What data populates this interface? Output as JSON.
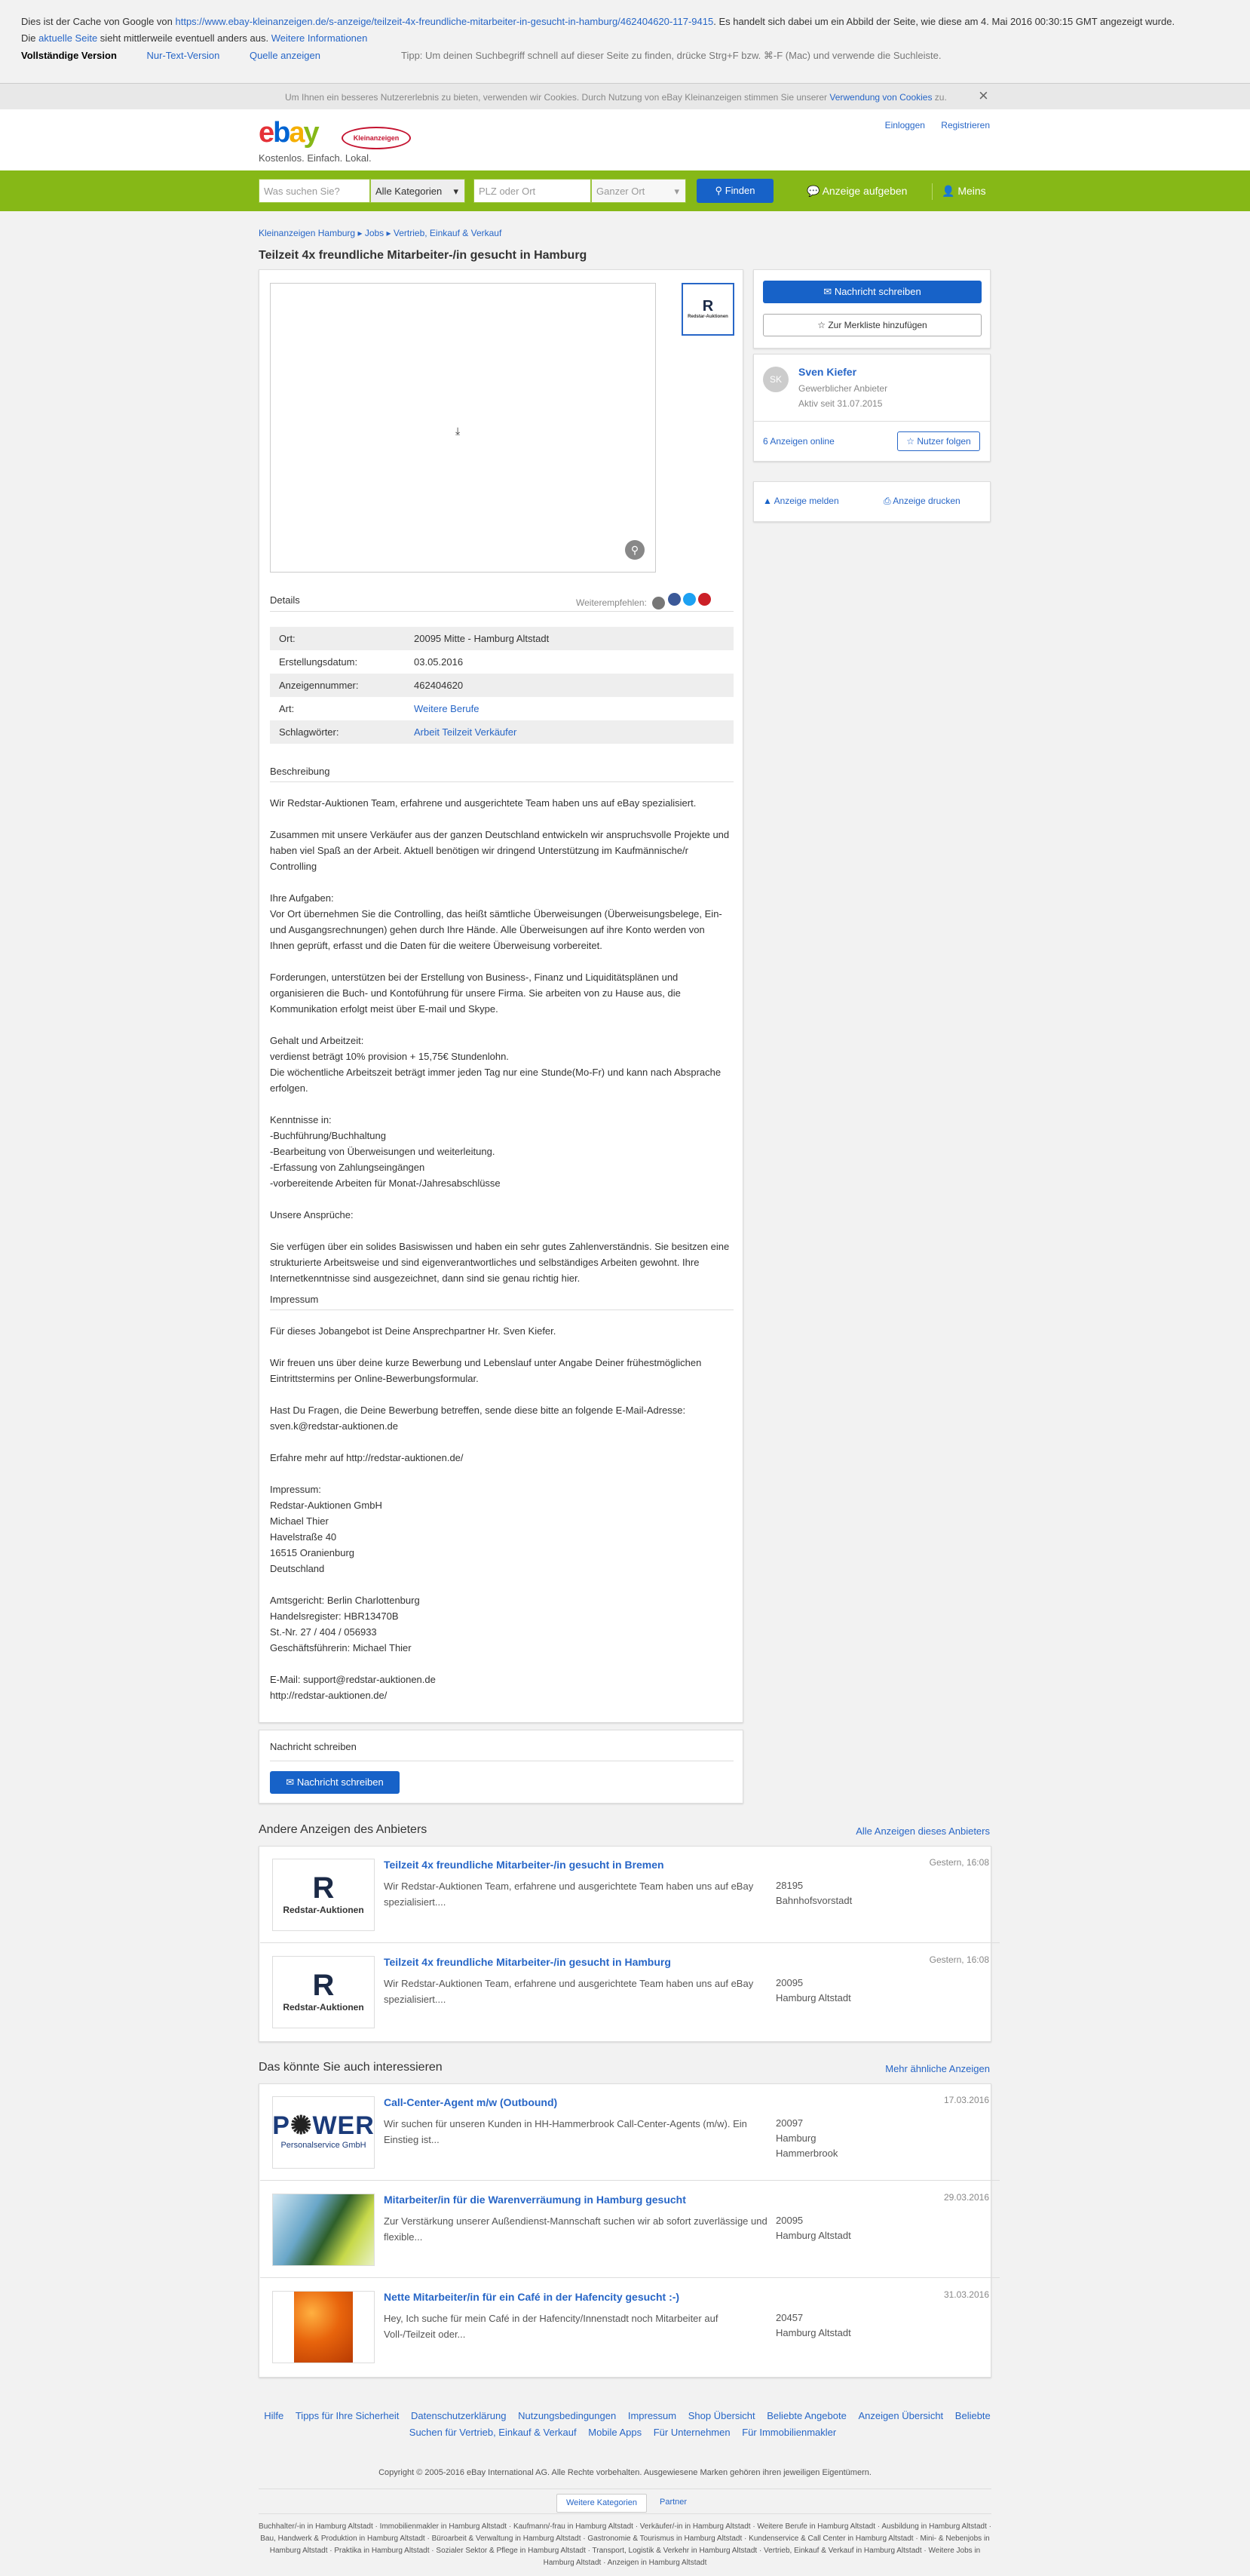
{
  "cache": {
    "p1_a": "Dies ist der Cache von Google von ",
    "p1_url": "https://www.ebay-kleinanzeigen.de/s-anzeige/teilzeit-4x-freundliche-mitarbeiter-in-gesucht-in-hamburg/462404620-117-9415",
    "p1_b": ". Es handelt sich dabei um ein Abbild der Seite, wie diese am 4. Mai 2016 00:30:15 GMT angezeigt wurde.",
    "p2_a": "Die ",
    "p2_link": "aktuelle Seite",
    "p2_b": " sieht mittlerweile eventuell anders aus. ",
    "p2_more": "Weitere Informationen",
    "full": "Vollständige Version",
    "text": "Nur-Text-Version",
    "source": "Quelle anzeigen",
    "tip": "Tipp: Um deinen Suchbegriff schnell auf dieser Seite zu finden, drücke Strg+F bzw. ⌘-F (Mac) und verwende die Suchleiste."
  },
  "cookie": {
    "text": "Um Ihnen ein besseres Nutzererlebnis zu bieten, verwenden wir Cookies. Durch Nutzung von eBay Kleinanzeigen stimmen Sie unserer ",
    "link": "Verwendung von Cookies",
    "end": " zu.",
    "close": "×"
  },
  "header": {
    "logo": "ebay",
    "badge": "Kleinanzeigen",
    "slogan": "Kostenlos. Einfach. Lokal.",
    "login": "Einloggen",
    "register": "Registrieren"
  },
  "search": {
    "placeholder": "Was suchen Sie?",
    "category": "Alle Kategorien",
    "plz": "PLZ oder Ort",
    "radius": "Ganzer Ort",
    "find": "Finden",
    "post": "Anzeige aufgeben",
    "mine": "Meins"
  },
  "breadcrumb": {
    "a": "Kleinanzeigen Hamburg",
    "b": "Jobs",
    "c": "Vertrieb, Einkauf & Verkauf"
  },
  "ad": {
    "title": "Teilzeit 4x freundliche Mitarbeiter-/in gesucht in Hamburg",
    "details": "Details",
    "share": "Weiterempfehlen:",
    "rows": [
      {
        "k": "Ort:",
        "v": "20095 Mitte - Hamburg Altstadt"
      },
      {
        "k": "Erstellungsdatum:",
        "v": "03.05.2016"
      },
      {
        "k": "Anzeigennummer:",
        "v": "462404620"
      },
      {
        "k": "Art:",
        "v": "Weitere Berufe"
      },
      {
        "k": "Schlagwörter:",
        "v": "Arbeit Teilzeit Verkäufer"
      }
    ],
    "desc_title": "Beschreibung",
    "description": "Wir Redstar-Auktionen Team, erfahrene und ausgerichtete Team haben uns auf eBay spezialisiert.\n\nZusammen mit unsere Verkäufer aus der ganzen Deutschland entwickeln wir anspruchsvolle Projekte und haben viel Spaß an der Arbeit. Aktuell benötigen wir dringend Unterstützung im Kaufmännische/r Controlling\n\nIhre Aufgaben:\nVor Ort übernehmen Sie die Controlling, das heißt sämtliche Überweisungen (Überweisungsbelege, Ein- und Ausgangsrechnungen) gehen durch Ihre Hände. Alle Überweisungen auf ihre Konto werden von Ihnen geprüft, erfasst und die Daten für die weitere Überweisung vorbereitet.\n\nForderungen, unterstützen bei der Erstellung von Business-, Finanz und Liquiditätsplänen und organisieren die Buch- und Kontoführung für unsere Firma. Sie arbeiten von zu Hause aus, die Kommunikation erfolgt meist über E-mail und Skype.\n\nGehalt und Arbeitzeit:\nverdienst beträgt 10% provision + 15,75€ Stundenlohn.\nDie wöchentliche Arbeitszeit beträgt immer jeden Tag nur eine Stunde(Mo-Fr) und kann nach Absprache erfolgen.\n\nKenntnisse in:\n-Buchführung/Buchhaltung\n-Bearbeitung von Überweisungen und weiterleitung.\n-Erfassung von Zahlungseingängen\n-vorbereitende Arbeiten für Monat-/Jahresabschlüsse\n\nUnsere Ansprüche:\n\nSie verfügen über ein solides Basiswissen und haben ein sehr gutes Zahlenverständnis. Sie besitzen eine strukturierte Arbeitsweise und sind eigenverantwortliches und selbständiges Arbeiten gewohnt. Ihre Internetkenntnisse sind ausgezeichnet, dann sind sie genau richtig hier.",
    "impressum_title": "Impressum",
    "impressum": "Für dieses Jobangebot ist Deine Ansprechpartner Hr. Sven Kiefer.\n\nWir freuen uns über deine kurze Bewerbung und Lebenslauf unter Angabe Deiner frühestmöglichen Eintrittstermins per Online-Bewerbungsformular.\n\nHast Du Fragen, die Deine Bewerbung betreffen, sende diese bitte an folgende E-Mail-Adresse:\nsven.k@redstar-auktionen.de\n\nErfahre mehr auf http://redstar-auktionen.de/\n\nImpressum:\nRedstar-Auktionen GmbH\nMichael Thier\nHavelstraße 40\n16515 Oranienburg\nDeutschland\n\nAmtsgericht: Berlin Charlottenburg\nHandelsregister: HBR13470B\nSt.-Nr. 27 / 404 / 056933\nGeschäftsführerin: Michael Thier\n\nE-Mail: support@redstar-auktionen.de\nhttp://redstar-auktionen.de/",
    "msg_title": "Nachricht schreiben",
    "msg_btn": "Nachricht schreiben"
  },
  "sidebar": {
    "msg_btn": "Nachricht schreiben",
    "watch_btn": "Zur Merkliste hinzufügen",
    "avatar": "SK",
    "seller": "Sven Kiefer",
    "type": "Gewerblicher Anbieter",
    "since": "Aktiv seit 31.07.2015",
    "count": "6 Anzeigen online",
    "follow": "Nutzer folgen",
    "report": "Anzeige melden",
    "print": "Anzeige drucken"
  },
  "brand": {
    "r": "R",
    "name": "Redstar-Auktionen"
  },
  "other": {
    "title": "Andere Anzeigen des Anbieters",
    "all": "Alle Anzeigen dieses Anbieters",
    "items": [
      {
        "t": "Teilzeit 4x freundliche Mitarbeiter-/in gesucht in Bremen",
        "d": "Wir Redstar-Auktionen Team, erfahrene und ausgerichtete Team haben uns auf eBay spezialisiert....",
        "loc": "28195\nBahnhofsvorstadt",
        "date": "Gestern, 16:08"
      },
      {
        "t": "Teilzeit 4x freundliche Mitarbeiter-/in gesucht in Hamburg",
        "d": "Wir Redstar-Auktionen Team, erfahrene und ausgerichtete Team haben uns auf eBay spezialisiert....",
        "loc": "20095\nHamburg Altstadt",
        "date": "Gestern, 16:08"
      }
    ]
  },
  "similar": {
    "title": "Das könnte Sie auch interessieren",
    "more": "Mehr ähnliche Anzeigen",
    "items": [
      {
        "t": "Call-Center-Agent m/w (Outbound)",
        "d": "Wir suchen für unseren Kunden in HH-Hammerbrook Call-Center-Agents (m/w). Ein Einstieg ist...",
        "loc": "20097\nHamburg\nHammerbrook",
        "date": "17.03.2016",
        "p1": "P",
        "p2": "WER",
        "p3": "Personalservice GmbH"
      },
      {
        "t": "Mitarbeiter/in für die Warenverräumung in Hamburg gesucht",
        "d": "Zur Verstärkung unserer Außendienst-Mannschaft suchen wir ab sofort zuverlässige und flexible...",
        "loc": "20095\nHamburg Altstadt",
        "date": "29.03.2016"
      },
      {
        "t": "Nette Mitarbeiter/in für ein Café in der Hafencity gesucht :-)",
        "d": "Hey, Ich suche für mein Café in der Hafencity/Innenstadt noch Mitarbeiter auf Voll-/Teilzeit oder...",
        "loc": "20457\nHamburg Altstadt",
        "date": "31.03.2016"
      }
    ]
  },
  "footer": {
    "links": [
      "Hilfe",
      "Tipps für Ihre Sicherheit",
      "Datenschutzerklärung",
      "Nutzungsbedingungen",
      "Impressum",
      "Shop Übersicht",
      "Beliebte Angebote",
      "Anzeigen Übersicht",
      "Beliebte Suchen für Vertrieb, Einkauf & Verkauf",
      "Mobile Apps",
      "Für Unternehmen",
      "Für Immobilienmakler"
    ],
    "copyright": "Copyright © 2005-2016 eBay International AG. Alle Rechte vorbehalten. Ausgewiesene Marken gehören ihren jeweiligen Eigentümern.",
    "tab1": "Weitere Kategorien",
    "tab2": "Partner",
    "seo": "Buchhalter/-in in Hamburg Altstadt · Immobilienmakler in Hamburg Altstadt · Kaufmann/-frau in Hamburg Altstadt · Verkäufer/-in in Hamburg Altstadt · Weitere Berufe in Hamburg Altstadt · Ausbildung in Hamburg Altstadt · Bau, Handwerk & Produktion in Hamburg Altstadt · Büroarbeit & Verwaltung in Hamburg Altstadt · Gastronomie & Tourismus in Hamburg Altstadt · Kundenservice & Call Center in Hamburg Altstadt · Mini- & Nebenjobs in Hamburg Altstadt · Praktika in Hamburg Altstadt · Sozialer Sektor & Pflege in Hamburg Altstadt · Transport, Logistik & Verkehr in Hamburg Altstadt · Vertrieb, Einkauf & Verkauf in Hamburg Altstadt · Weitere Jobs in Hamburg Altstadt · Anzeigen in Hamburg Altstadt"
  },
  "colors": {
    "green": "#86b817",
    "blue": "#1762c8",
    "link": "#2766c7"
  }
}
